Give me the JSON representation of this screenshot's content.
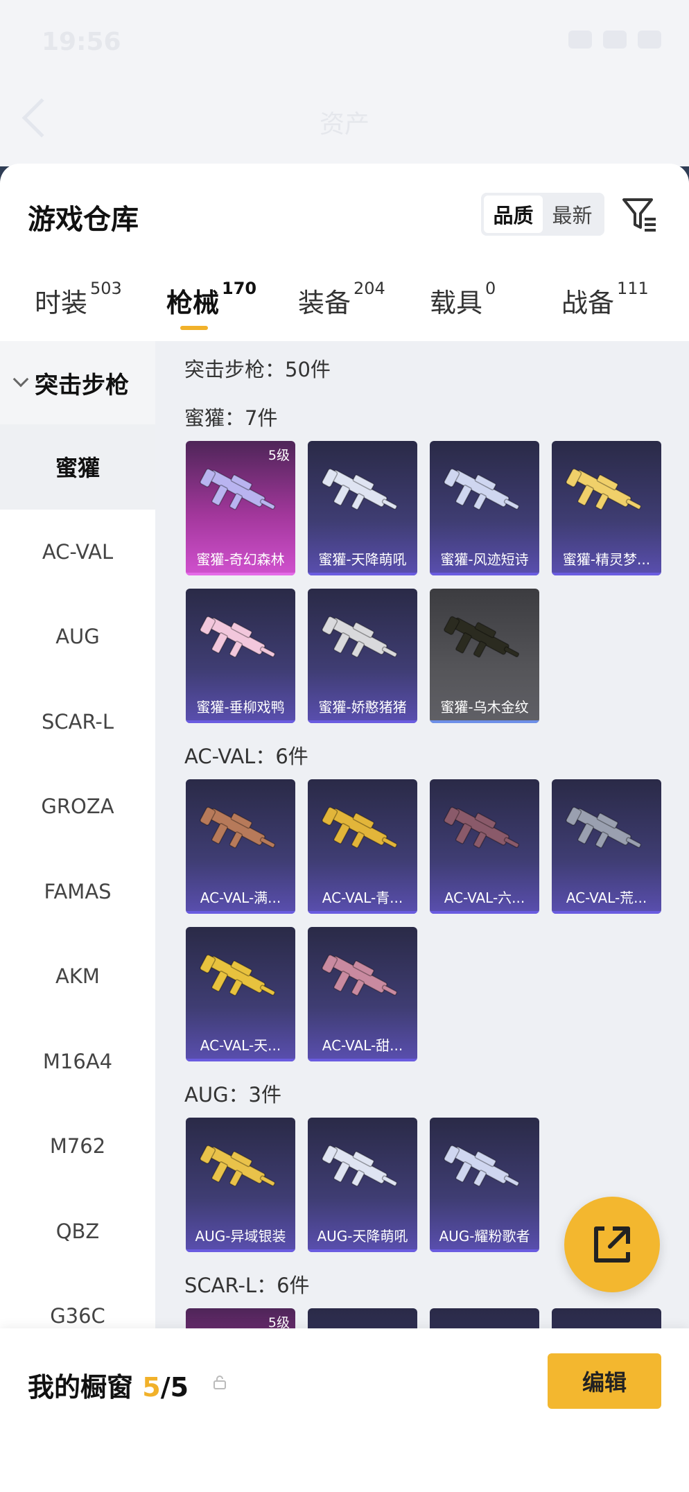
{
  "statusbar": {
    "time": "19:56"
  },
  "nav": {
    "title": "资产"
  },
  "sheet": {
    "title": "游戏仓库",
    "sort_options": [
      "品质",
      "最新"
    ],
    "tabs": [
      {
        "label": "时装",
        "count": "503"
      },
      {
        "label": "枪械",
        "count": "170"
      },
      {
        "label": "装备",
        "count": "204"
      },
      {
        "label": "载具",
        "count": "0"
      },
      {
        "label": "战备",
        "count": "111"
      }
    ]
  },
  "sidebar": {
    "header": "突击步枪",
    "items": [
      "蜜獾",
      "AC-VAL",
      "AUG",
      "SCAR-L",
      "GROZA",
      "FAMAS",
      "AKM",
      "M16A4",
      "M762",
      "QBZ",
      "G36C"
    ]
  },
  "content": {
    "category_total": "突击步枪：50件",
    "sections": [
      {
        "title": "蜜獾：7件",
        "items": [
          {
            "label": "蜜獾-奇幻森林",
            "level": "5级",
            "style": "pink"
          },
          {
            "label": "蜜獾-天降萌吼",
            "style": "purple"
          },
          {
            "label": "蜜獾-风迹短诗",
            "style": "purple"
          },
          {
            "label": "蜜獾-精灵梦...",
            "style": "purple"
          },
          {
            "label": "蜜獾-垂柳戏鸭",
            "style": "purple"
          },
          {
            "label": "蜜獾-娇憨猪猪",
            "style": "purple"
          },
          {
            "label": "蜜獾-乌木金纹",
            "style": "grey"
          }
        ]
      },
      {
        "title": "AC-VAL：6件",
        "items": [
          {
            "label": "AC-VAL-满...",
            "style": "purple"
          },
          {
            "label": "AC-VAL-青...",
            "style": "purple"
          },
          {
            "label": "AC-VAL-六...",
            "style": "purple"
          },
          {
            "label": "AC-VAL-荒...",
            "style": "purple"
          },
          {
            "label": "AC-VAL-天...",
            "style": "purple"
          },
          {
            "label": "AC-VAL-甜...",
            "style": "purple"
          }
        ]
      },
      {
        "title": "AUG：3件",
        "items": [
          {
            "label": "AUG-异域银装",
            "style": "purple"
          },
          {
            "label": "AUG-天降萌吼",
            "style": "purple"
          },
          {
            "label": "AUG-耀粉歌者",
            "style": "purple"
          }
        ]
      },
      {
        "title": "SCAR-L：6件",
        "items": [
          {
            "label": "",
            "level": "5级",
            "style": "pink"
          },
          {
            "label": "",
            "style": "purple"
          },
          {
            "label": "",
            "style": "purple"
          },
          {
            "label": "",
            "style": "purple"
          }
        ]
      }
    ]
  },
  "bottom": {
    "title": "我的橱窗",
    "current": "5",
    "total": "/5",
    "edit_label": "编辑"
  },
  "colors": {
    "accent": "#f3b72f",
    "tab_underline": "#f1b12a",
    "card_purple": "#3f3d73",
    "card_pink": "#a2379b"
  }
}
